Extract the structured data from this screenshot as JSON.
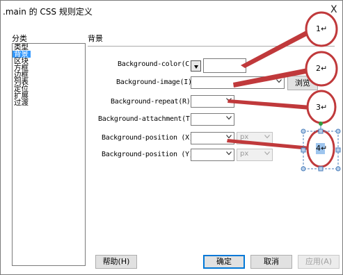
{
  "window": {
    "title": ".main 的 CSS 规则定义",
    "close_glyph": "X"
  },
  "category_panel": {
    "header": "分类",
    "items": [
      {
        "label": "类型"
      },
      {
        "label": "背景"
      },
      {
        "label": "区块"
      },
      {
        "label": "方框"
      },
      {
        "label": "边框"
      },
      {
        "label": "列表"
      },
      {
        "label": "定位"
      },
      {
        "label": "扩展"
      },
      {
        "label": "过渡"
      }
    ],
    "selected": "背景"
  },
  "section": {
    "title": "背景"
  },
  "form": {
    "bg_color_label": "Background-color(C):",
    "bg_color_value": "",
    "bg_image_label": "Background-image(I):",
    "bg_image_value": "",
    "browse_button": "浏览",
    "bg_repeat_label": "Background-repeat(R):",
    "bg_repeat_value": "",
    "bg_attachment_label": "Background-attachment(T):",
    "bg_attachment_value": "",
    "bg_position_x_label": "Background-position (X):",
    "bg_position_x_value": "",
    "bg_position_x_unit": "px",
    "bg_position_y_label": "Background-position (Y):",
    "bg_position_y_value": "",
    "bg_position_y_unit": "px"
  },
  "footer": {
    "help": "帮助(H)",
    "ok": "确定",
    "cancel": "取消",
    "apply": "应用(A)"
  },
  "annotations": {
    "callouts": [
      "1↵",
      "2↵",
      "3↵",
      "4↵"
    ],
    "arrow_color": "#c0393b",
    "selection_color": "#4a7ebb",
    "highlight_color": "#9ec5ee"
  },
  "icons": {
    "combo_arrow": "chevron-down-icon",
    "color_swatch_arrow": "triangle-down-icon",
    "close": "close-icon"
  }
}
